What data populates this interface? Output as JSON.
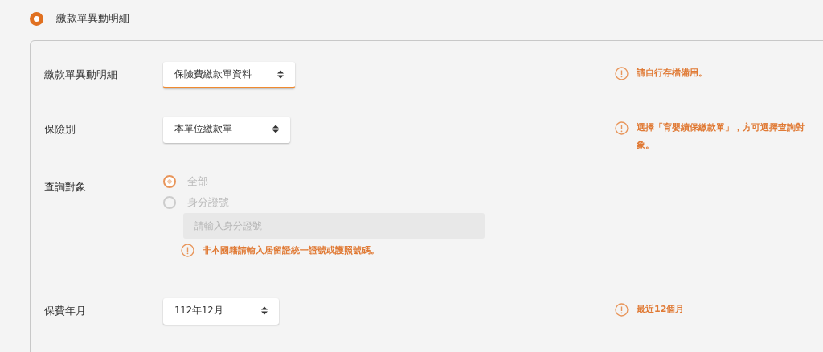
{
  "section_radio": {
    "label": "繳款單異動明細",
    "selected": true
  },
  "form": {
    "rows": [
      {
        "kind": "select",
        "label": "繳款單異動明細",
        "value": "保險費繳款單資料",
        "focused": true,
        "note": "請自行存檔備用。"
      },
      {
        "kind": "select",
        "label": "保險別",
        "value": "本單位繳款單",
        "focused": false,
        "note": "選擇「育嬰續保繳款單」，方可選擇查詢對象。"
      },
      {
        "kind": "radio-group",
        "label": "查詢對象",
        "disabled": true,
        "options": [
          {
            "label": "全部",
            "selected": true
          },
          {
            "label": "身分證號",
            "selected": false
          }
        ],
        "input": {
          "placeholder": "請輸入身分證號"
        },
        "hint": "非本國籍請輸入居留證統一證號或護照號碼。"
      },
      {
        "kind": "select",
        "label": "保費年月",
        "value": "112年12月",
        "focused": false,
        "note": "最近12個月"
      }
    ]
  }
}
